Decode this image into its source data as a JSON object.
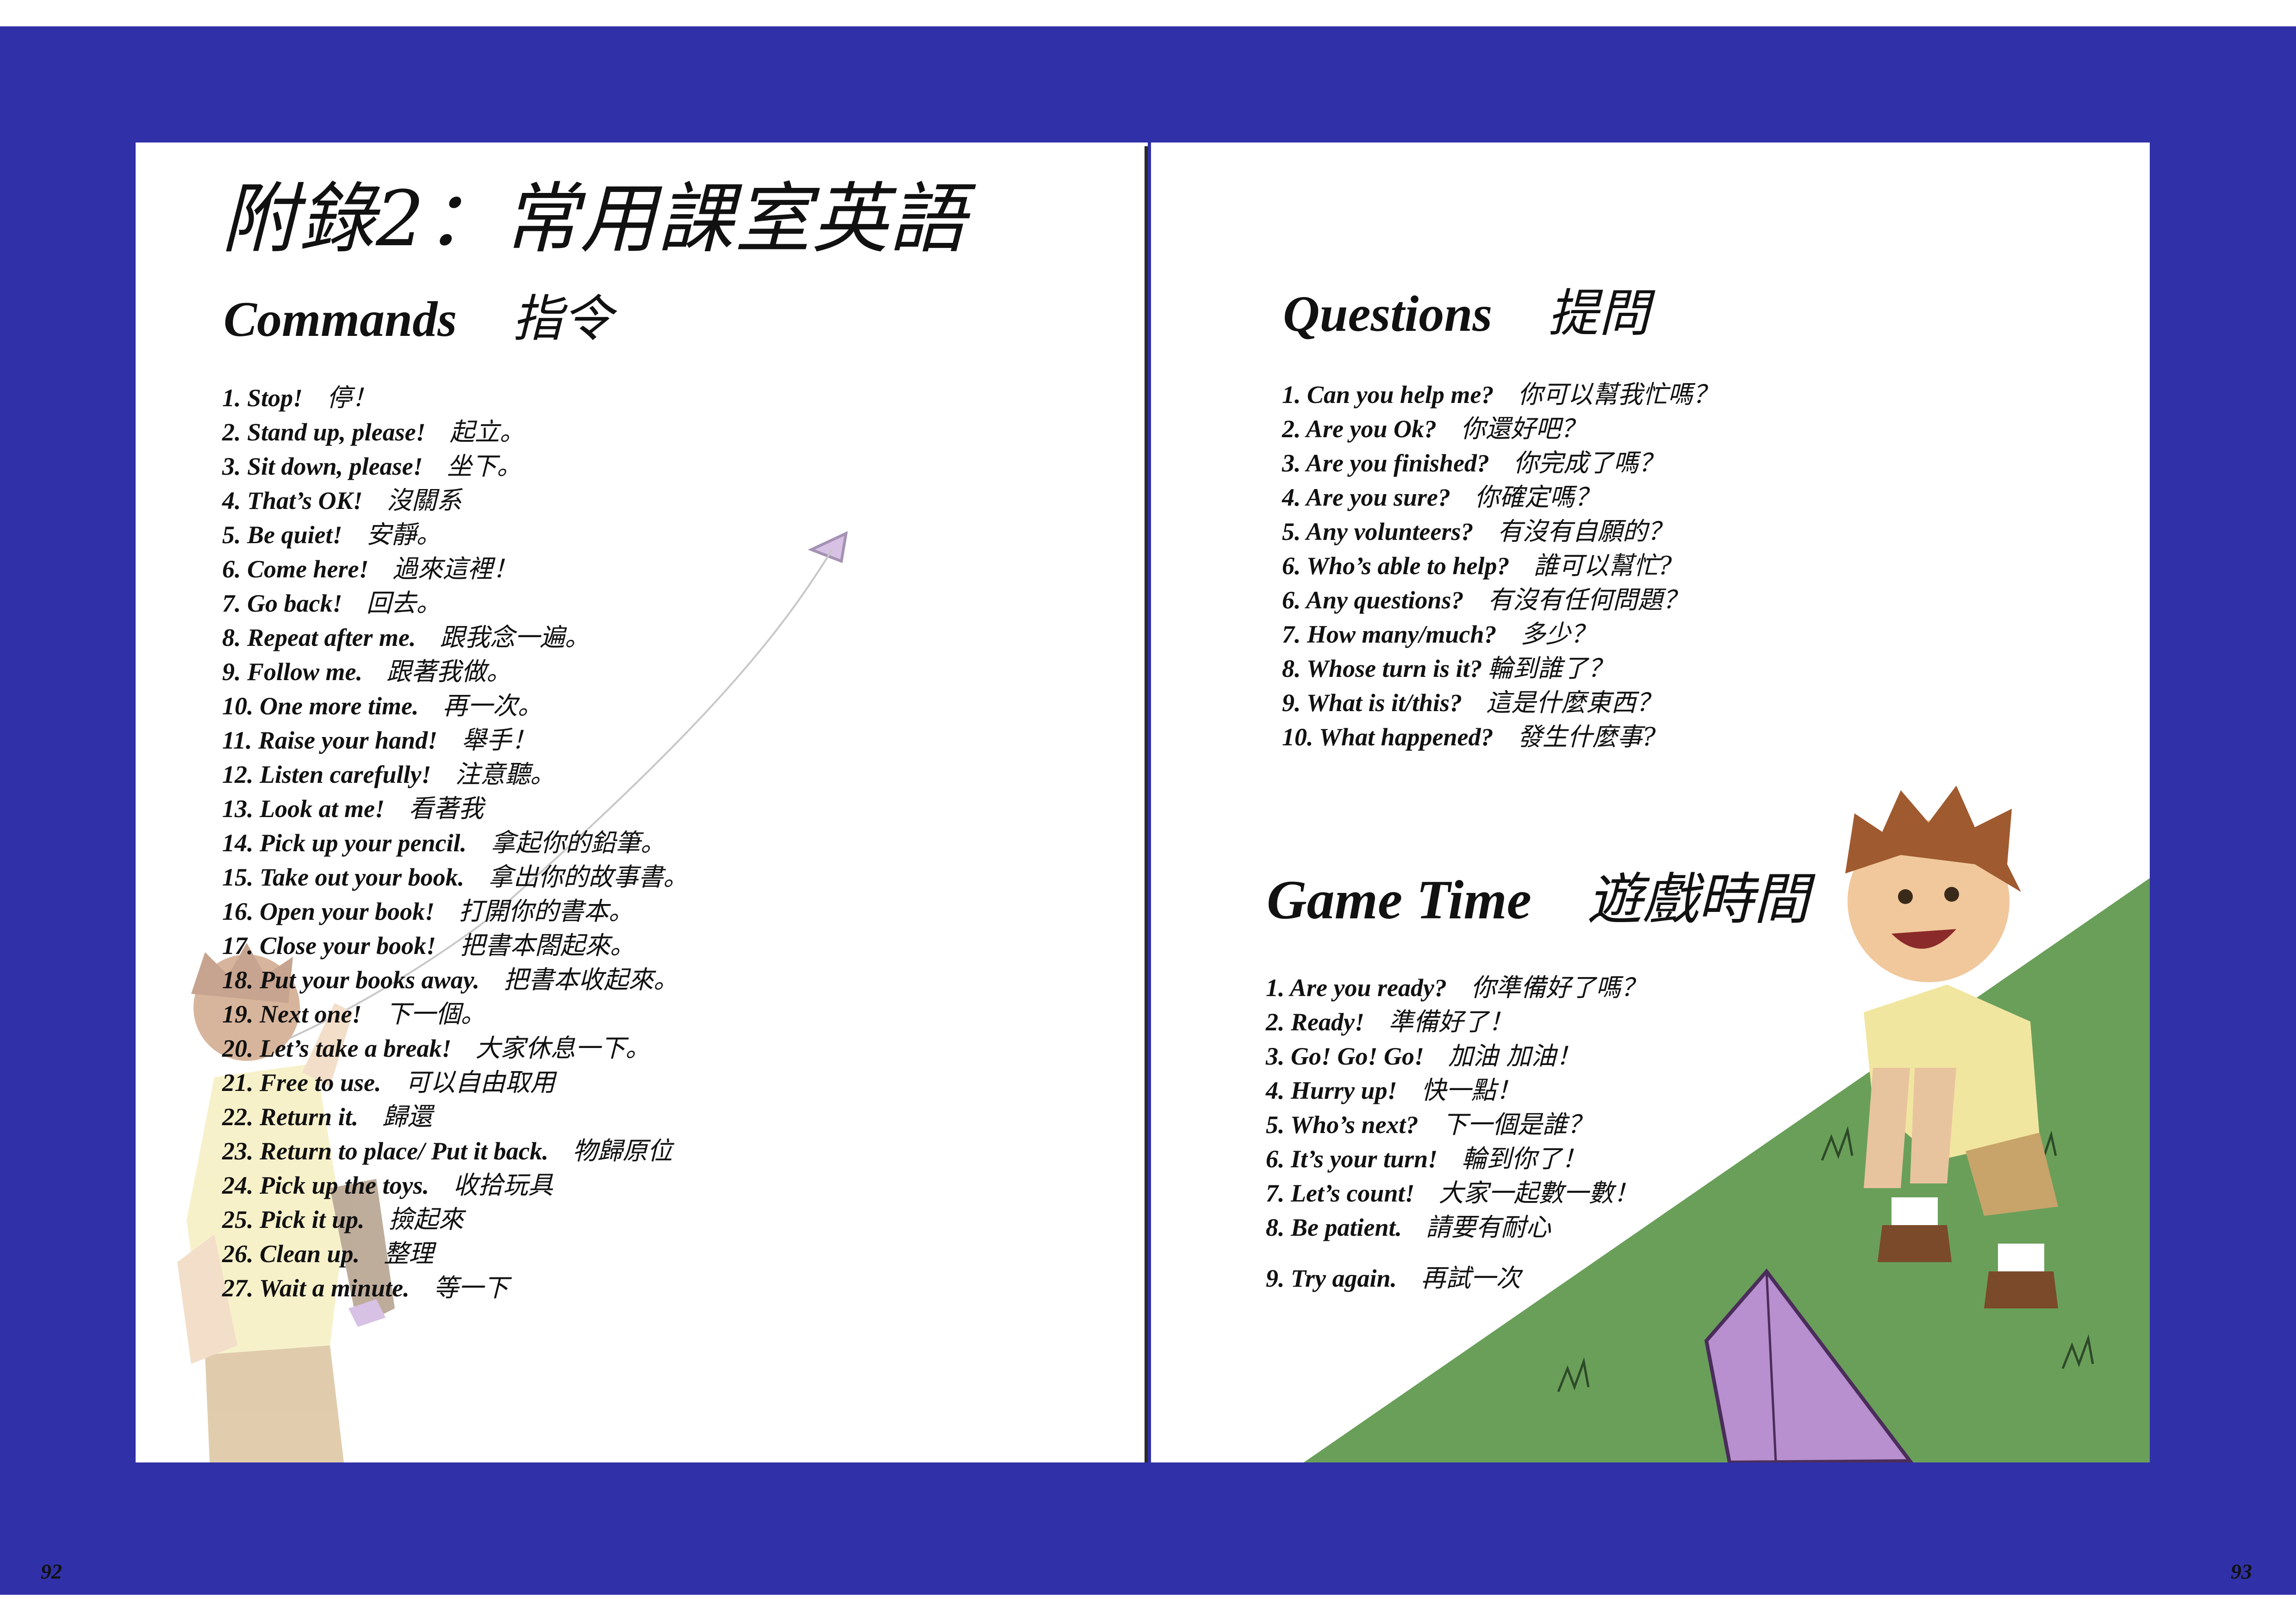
{
  "left_page": {
    "title": "附錄2：常用課室英語",
    "section": {
      "en": "Commands",
      "zh": "指令"
    },
    "items": [
      {
        "en": "1. Stop!",
        "zh": "停！"
      },
      {
        "en": "2. Stand up, please!",
        "zh": "起立。"
      },
      {
        "en": "3. Sit down, please!",
        "zh": "坐下。"
      },
      {
        "en": "4. That’s OK!",
        "zh": "沒關系"
      },
      {
        "en": "5. Be quiet!",
        "zh": "安靜。"
      },
      {
        "en": "6. Come here!",
        "zh": "過來這裡！"
      },
      {
        "en": "7. Go back!",
        "zh": "回去。"
      },
      {
        "en": "8. Repeat after me.",
        "zh": "跟我念一遍。"
      },
      {
        "en": "9. Follow me.",
        "zh": "跟著我做。"
      },
      {
        "en": "10. One more time.",
        "zh": "再一次。"
      },
      {
        "en": "11. Raise your hand!",
        "zh": "舉手！"
      },
      {
        "en": "12. Listen carefully!",
        "zh": "注意聽。"
      },
      {
        "en": "13. Look at me!",
        "zh": "看著我"
      },
      {
        "en": "14. Pick up your pencil.",
        "zh": "拿起你的鉛筆。"
      },
      {
        "en": "15. Take out your book.",
        "zh": "拿出你的故事書。"
      },
      {
        "en": "16. Open your book!",
        "zh": "打開你的書本。"
      },
      {
        "en": "17. Close your book!",
        "zh": "把書本閤起來。"
      },
      {
        "en": "18. Put your books away.",
        "zh": "把書本收起來。"
      },
      {
        "en": "19. Next one!",
        "zh": "下一個。"
      },
      {
        "en": "20. Let’s take a break!",
        "zh": "大家休息一下。"
      },
      {
        "en": "21. Free to use.",
        "zh": "可以自由取用"
      },
      {
        "en": "22. Return it.",
        "zh": "歸還"
      },
      {
        "en": "23. Return to place/ Put it back.",
        "zh": "物歸原位"
      },
      {
        "en": "24. Pick up the toys.",
        "zh": "收拾玩具"
      },
      {
        "en": "25. Pick it up.",
        "zh": "撿起來"
      },
      {
        "en": "26. Clean up.",
        "zh": "整理"
      },
      {
        "en": "27. Wait a minute.",
        "zh": "等一下"
      }
    ],
    "page_number": "92"
  },
  "right_page": {
    "questions": {
      "section": {
        "en": "Questions",
        "zh": "提問"
      },
      "items": [
        {
          "en": "1. Can you help me?",
          "zh": "你可以幫我忙嗎？"
        },
        {
          "en": "2. Are you Ok?",
          "zh": "你還好吧？"
        },
        {
          "en": "3. Are you finished?",
          "zh": "你完成了嗎？"
        },
        {
          "en": "4. Are you sure?",
          "zh": "你確定嗎？"
        },
        {
          "en": "5. Any volunteers?",
          "zh": "有沒有自願的？"
        },
        {
          "en": "6. Who’s able to help?",
          "zh": "誰可以幫忙?"
        },
        {
          "en": "6. Any questions?",
          "zh": "有沒有任何問題？"
        },
        {
          "en": "7. How many/much?",
          "zh": "多少？"
        },
        {
          "en": "8. Whose turn is it?",
          "zh": "輪到誰了？"
        },
        {
          "en": "9. What is it/this?",
          "zh": "這是什麼東西？"
        },
        {
          "en": "10. What happened?",
          "zh": "發生什麼事?"
        }
      ]
    },
    "game_time": {
      "section": {
        "en": "Game Time",
        "zh": "遊戲時間"
      },
      "items": [
        {
          "en": "1. Are you ready?",
          "zh": "你準備好了嗎？"
        },
        {
          "en": "2. Ready!",
          "zh": "準備好了！"
        },
        {
          "en": "3. Go! Go! Go!",
          "zh": "加油 加油！"
        },
        {
          "en": "4. Hurry up!",
          "zh": "快一點！"
        },
        {
          "en": "5. Who’s next?",
          "zh": "下一個是誰？"
        },
        {
          "en": "6. It’s your turn!",
          "zh": "輪到你了！"
        },
        {
          "en": "7. Let’s count!",
          "zh": "大家一起數一數！"
        },
        {
          "en": "8. Be patient.",
          "zh": "請要有耐心"
        },
        {
          "en": "9. Try again.",
          "zh": "再試一次"
        }
      ]
    },
    "page_number": "93"
  },
  "colors": {
    "background_band": "#3030a8",
    "page": "#ffffff",
    "text": "#111111",
    "grass": "#6a9f5a",
    "kite": "#b88fcf"
  }
}
